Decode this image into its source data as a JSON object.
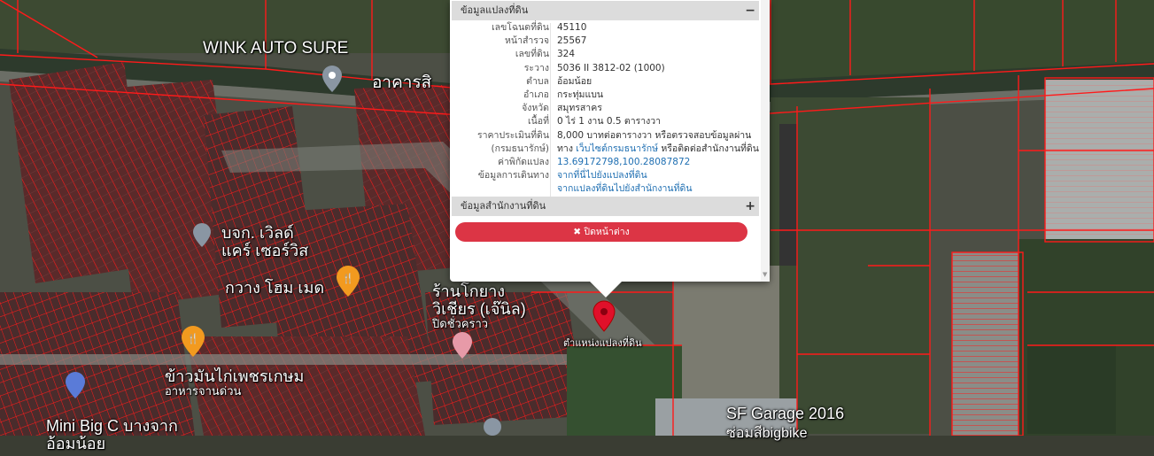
{
  "map_labels": {
    "wink": "WINK AUTO SURE",
    "wink_thai": "อาคารสิ",
    "company": "บจก. เวิลด์",
    "company2": "แคร์ เซอร์วิส",
    "kwang": "กวาง โฮม เมด",
    "shop": "ร้านโกยาง",
    "shop2": "วิเชียร (เจ๊นิล)",
    "shop3": "ปิดชั่วคราว",
    "khaoman": "ข้าวมันไก่เพชรเกษม",
    "khaoman2": "อาหารจานด่วน",
    "minibigc": "Mini Big C บางจาก",
    "minibigc2": "อ้อมน้อย",
    "sfgarage": "SF Garage 2016",
    "sfgarage2": "ซ่อมสีbigbike",
    "parcel_marker": "ตำแหน่งแปลงที่ดิน"
  },
  "popup": {
    "header_info": "ข้อมูลแปลงที่ดิน",
    "header_info_sign": "−",
    "rows": [
      {
        "key": "เลขโฉนดที่ดิน",
        "value": "45110"
      },
      {
        "key": "หน้าสำรวจ",
        "value": "25567"
      },
      {
        "key": "เลขที่ดิน",
        "value": "324"
      },
      {
        "key": "ระวาง",
        "value": "5036 II 3812-02 (1000)"
      },
      {
        "key": "ตำบล",
        "value": "อ้อมน้อย"
      },
      {
        "key": "อำเภอ",
        "value": "กระทุ่มแบน"
      },
      {
        "key": "จังหวัด",
        "value": "สมุทรสาคร"
      },
      {
        "key": "เนื้อที่",
        "value": "0 ไร่ 1 งาน 0.5 ตารางวา"
      },
      {
        "key": "ราคาประเมินที่ดิน",
        "value": "8,000 บาทต่อตารางวา หรือตรวจสอบข้อมูลผ่าน"
      },
      {
        "key": "(กรมธนารักษ์)",
        "value_prefix": "ทาง ",
        "value_link": "เว็บไซต์กรมธนารักษ์",
        "value_suffix": " หรือติดต่อสำนักงานที่ดิน"
      },
      {
        "key": "ค่าพิกัดแปลง",
        "value": "13.69172798,100.28087872",
        "link": true
      },
      {
        "key": "ข้อมูลการเดินทาง",
        "value": "จากที่นี่ไปยังแปลงที่ดิน",
        "link": true
      },
      {
        "key": "",
        "value": "จากแปลงที่ดินไปยังสำนักงานที่ดิน",
        "link": true
      }
    ],
    "header_office": "ข้อมูลสำนักงานที่ดิน",
    "header_office_sign": "+",
    "close_button": "✖ ปิดหน้าต่าง"
  },
  "colors": {
    "parcel_line": "#ff1a1a",
    "button_red": "#dc3545",
    "link_blue": "#1f6fb2"
  }
}
